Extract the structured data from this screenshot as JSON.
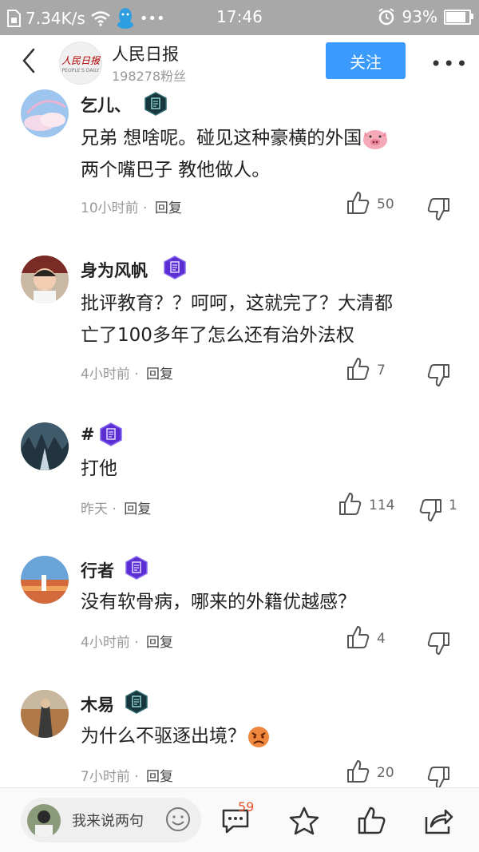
{
  "status_bar": {
    "speed": "7.34K/s",
    "time": "17:46",
    "battery": "93%"
  },
  "header": {
    "account_name": "人民日报",
    "logo_text": "人民日报",
    "logo_sub": "PEOPLE'S DAILY",
    "fans": "198278粉丝",
    "follow_label": "关注"
  },
  "comments": [
    {
      "username": "乞儿、",
      "text_line1": "兄弟 想啥呢。碰见这种豪横的外国",
      "text_line2": "两个嘴巴子 教他做人。",
      "time": "10小时前",
      "reply_label": "回复",
      "likes": "50",
      "dislikes": ""
    },
    {
      "username": "身为风帆",
      "text_line1": "批评教育？？呵呵，这就完了？大清都",
      "text_line2": "亡了100多年了怎么还有治外法权",
      "time": "4小时前",
      "reply_label": "回复",
      "likes": "7",
      "dislikes": ""
    },
    {
      "username": "#",
      "text_line1": "打他",
      "time": "昨天",
      "reply_label": "回复",
      "likes": "114",
      "dislikes": "1"
    },
    {
      "username": "行者",
      "text_line1": "没有软骨病，哪来的外籍优越感？",
      "time": "4小时前",
      "reply_label": "回复",
      "likes": "4",
      "dislikes": ""
    },
    {
      "username": "木易",
      "text_line1": "为什么不驱逐出境？",
      "time": "7小时前",
      "reply_label": "回复",
      "likes": "20",
      "dislikes": ""
    }
  ],
  "bottom_bar": {
    "input_placeholder": "我来说两句",
    "comment_count": "59"
  },
  "colors": {
    "accent": "#3a9bfc",
    "badge_teal": "#16363b",
    "badge_purple": "#5b2ed3",
    "count_red": "#e8542e"
  }
}
